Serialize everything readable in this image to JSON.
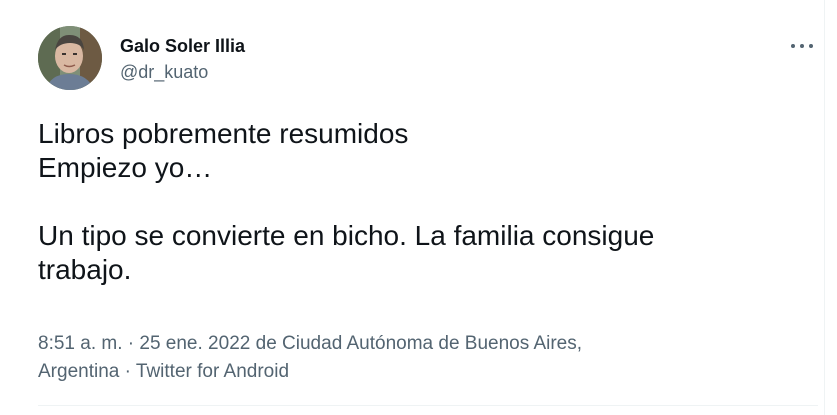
{
  "author": {
    "display_name": "Galo Soler Illia",
    "handle": "@dr_kuato",
    "avatar_icon": "user-photo-avatar"
  },
  "tweet": {
    "lines": [
      "Libros pobremente resumidos",
      "Empiezo yo…",
      "",
      "Un tipo se convierte en bicho. La familia consigue",
      "trabajo."
    ]
  },
  "meta": {
    "time": "8:51 a. m.",
    "separator": "·",
    "date": "25 ene. 2022",
    "location_prefix": "de",
    "location_line1": "Ciudad Autónoma de Buenos Aires,",
    "location_line2": "Argentina",
    "source": "Twitter for Android"
  },
  "colors": {
    "text_primary": "#0f1419",
    "text_secondary": "#536471",
    "border": "#eff3f4"
  },
  "icons": {
    "more": "more-options-icon"
  }
}
